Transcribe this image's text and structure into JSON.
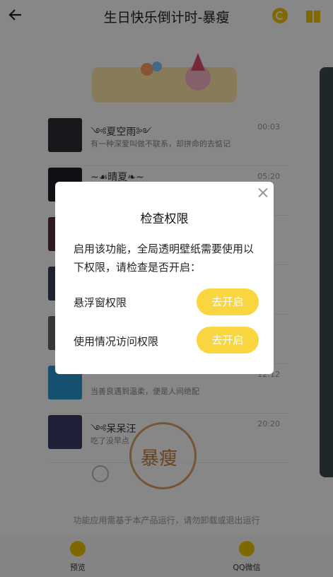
{
  "header": {
    "title": "生日快乐倒计时-暴瘦"
  },
  "list": [
    {
      "name": "༺夏空雨༻",
      "msg": "有一种深爱叫做不联系，却拼命的去惦记",
      "time": "00:03",
      "avatar_color": "#2f2f38"
    },
    {
      "name": "~☙晴夏❧~",
      "msg": "",
      "time": "05:20",
      "avatar_color": "#202028"
    },
    {
      "name": "",
      "msg": "",
      "time": "",
      "avatar_color": "#5a2f3a"
    },
    {
      "name": "",
      "msg": "",
      "time": "",
      "avatar_color": "#3a3f5a"
    },
    {
      "name": "",
      "msg": "",
      "time": "",
      "avatar_color": "#666"
    },
    {
      "name": "",
      "msg": "当善良遇到温柔，便是人间绝配",
      "time": "12:12",
      "avatar_color": "#2a9ad1"
    },
    {
      "name": "༺呆呆汪",
      "msg": "吃了没早点",
      "time": "20:20",
      "avatar_color": "#3c3c6a"
    }
  ],
  "stamp_text": "暴瘦",
  "footer_note": "功能应用需基于本产品运行，请勿卸载或退出运行",
  "nav": {
    "preview": "预览",
    "qq_wechat": "QQ微信"
  },
  "dialog": {
    "title": "检查权限",
    "desc": "启用该功能，全局透明壁纸需要使用以下权限，请检查是否开启：",
    "perm1": "悬浮窗权限",
    "perm2": "使用情况访问权限",
    "btn1": "去开启",
    "btn2": "去开启"
  },
  "colors": {
    "accent": "#f9d63f",
    "brand_yellow": "#f3c400"
  }
}
